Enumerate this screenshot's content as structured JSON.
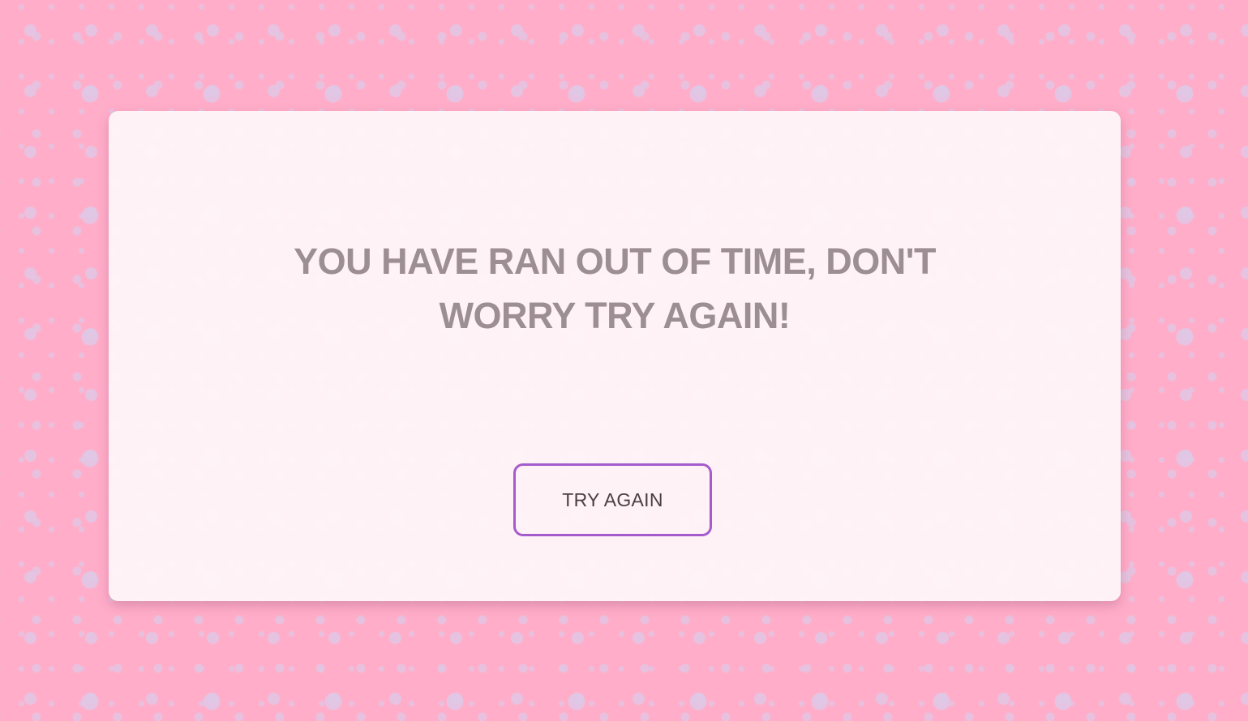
{
  "timeout_card": {
    "message": "YOU HAVE RAN OUT OF TIME, DON'T WORRY TRY AGAIN!",
    "button_label": "TRY AGAIN"
  },
  "colors": {
    "background": "#ffadc9",
    "dots": "#dfc8e6",
    "card": "#fff6f9",
    "message_text": "#9c8e93",
    "button_border": "#a55bcc",
    "button_text": "#4a3e44"
  }
}
